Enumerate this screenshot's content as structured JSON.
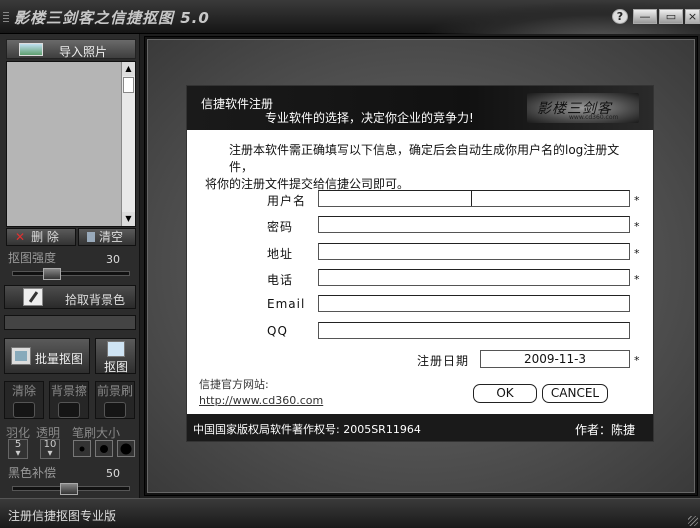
{
  "app": {
    "title": "影楼三剑客之信捷抠图 5.0"
  },
  "window_controls": {
    "help": "?",
    "minimize": "—",
    "maximize": "▭",
    "close": "×"
  },
  "left_panel": {
    "import_label": "导入照片",
    "delete_label": "删 除",
    "clear_label": "清空",
    "strength_label": "抠图强度",
    "strength_value": "30",
    "pick_bg_label": "拾取背景色",
    "batch_label": "批量抠图",
    "cut_label": "抠图",
    "tools": [
      "清除",
      "背景擦",
      "前景刷"
    ],
    "feather_label": "羽化",
    "feather_value": "5",
    "transparency_label": "透明",
    "transparency_value": "10",
    "brush_size_label": "笔刷大小",
    "black_comp_label": "黑色补偿",
    "black_comp_value": "50"
  },
  "dialog": {
    "title": "信捷软件注册",
    "slogan": "专业软件的选择，决定你企业的竞争力!",
    "logo_text": "影楼三剑客",
    "logo_url": "www.cd360.com",
    "intro_line1": "注册本软件需正确填写以下信息，确定后会自动生成你用户名的log注册文件，",
    "intro_line2": "将你的注册文件提交给信捷公司即可。",
    "fields": [
      {
        "label": "用户名",
        "value": "",
        "required": "*"
      },
      {
        "label": "密码",
        "value": "",
        "required": "*"
      },
      {
        "label": "地址",
        "value": "",
        "required": "*"
      },
      {
        "label": "电话",
        "value": "",
        "required": "*"
      },
      {
        "label": "Email",
        "value": "",
        "required": ""
      },
      {
        "label": "QQ",
        "value": "",
        "required": ""
      }
    ],
    "date_label": "注册日期",
    "date_value": "2009-11-3",
    "date_required": "*",
    "site_label": "信捷官方网站:",
    "site_url": "http://www.cd360.com",
    "ok_label": "OK",
    "cancel_label": "CANCEL",
    "copyright": "中国国家版权局软件著作权号: 2005SR11964",
    "author": "作者：陈捷"
  },
  "status_bar": {
    "text": "注册信捷抠图专业版"
  }
}
